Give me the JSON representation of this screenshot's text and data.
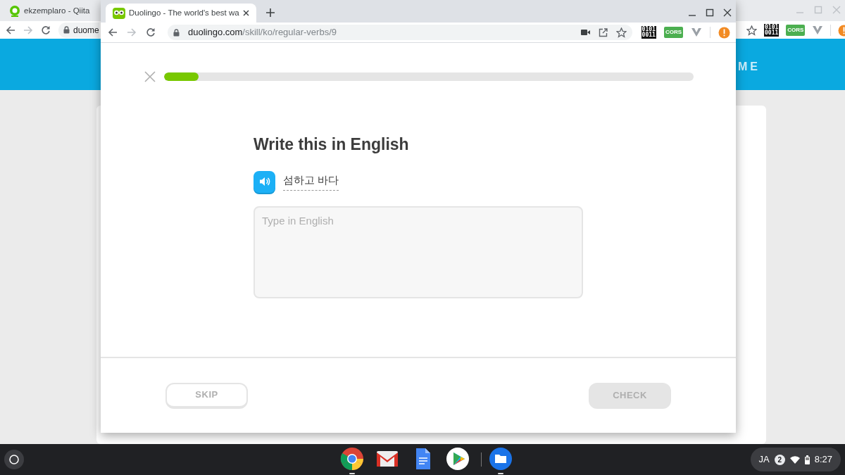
{
  "back_window": {
    "tab": {
      "title": "ekzemplaro - Qiita"
    },
    "address": "duome",
    "banner_text": "ME",
    "extensions": [
      {
        "kind": "binary",
        "lines": [
          "0101",
          "0011"
        ]
      },
      {
        "kind": "cors",
        "label": "CORS"
      },
      {
        "kind": "vee"
      },
      {
        "kind": "alert"
      }
    ]
  },
  "front_window": {
    "tab": {
      "title": "Duolingo - The world's best wa",
      "selected": true
    },
    "address": {
      "host": "duolingo.com",
      "path": "/skill/ko/regular-verbs/9"
    },
    "extensions": [
      {
        "kind": "binary",
        "lines": [
          "0101",
          "0011"
        ]
      },
      {
        "kind": "cors",
        "label": "CORS"
      },
      {
        "kind": "vee"
      },
      {
        "kind": "alert"
      }
    ],
    "lesson": {
      "progress": {
        "level": 0.065
      },
      "prompt": "Write this in English",
      "sentence": "섬하고 바다",
      "answer": {
        "placeholder": "Type in English"
      },
      "buttons": [
        {
          "label": "SKIP",
          "kind": "secondary",
          "disabled": false
        },
        {
          "label": "CHECK",
          "kind": "primary",
          "disabled": true
        }
      ]
    }
  },
  "shelf": {
    "apps": [
      {
        "kind": "chrome",
        "running": true
      },
      {
        "kind": "mail",
        "running": false
      },
      {
        "kind": "docs",
        "running": false
      },
      {
        "kind": "play",
        "running": false
      },
      {
        "kind": "files",
        "running": true
      }
    ],
    "ime": "JA",
    "notifications": "2",
    "time": "8:27"
  }
}
